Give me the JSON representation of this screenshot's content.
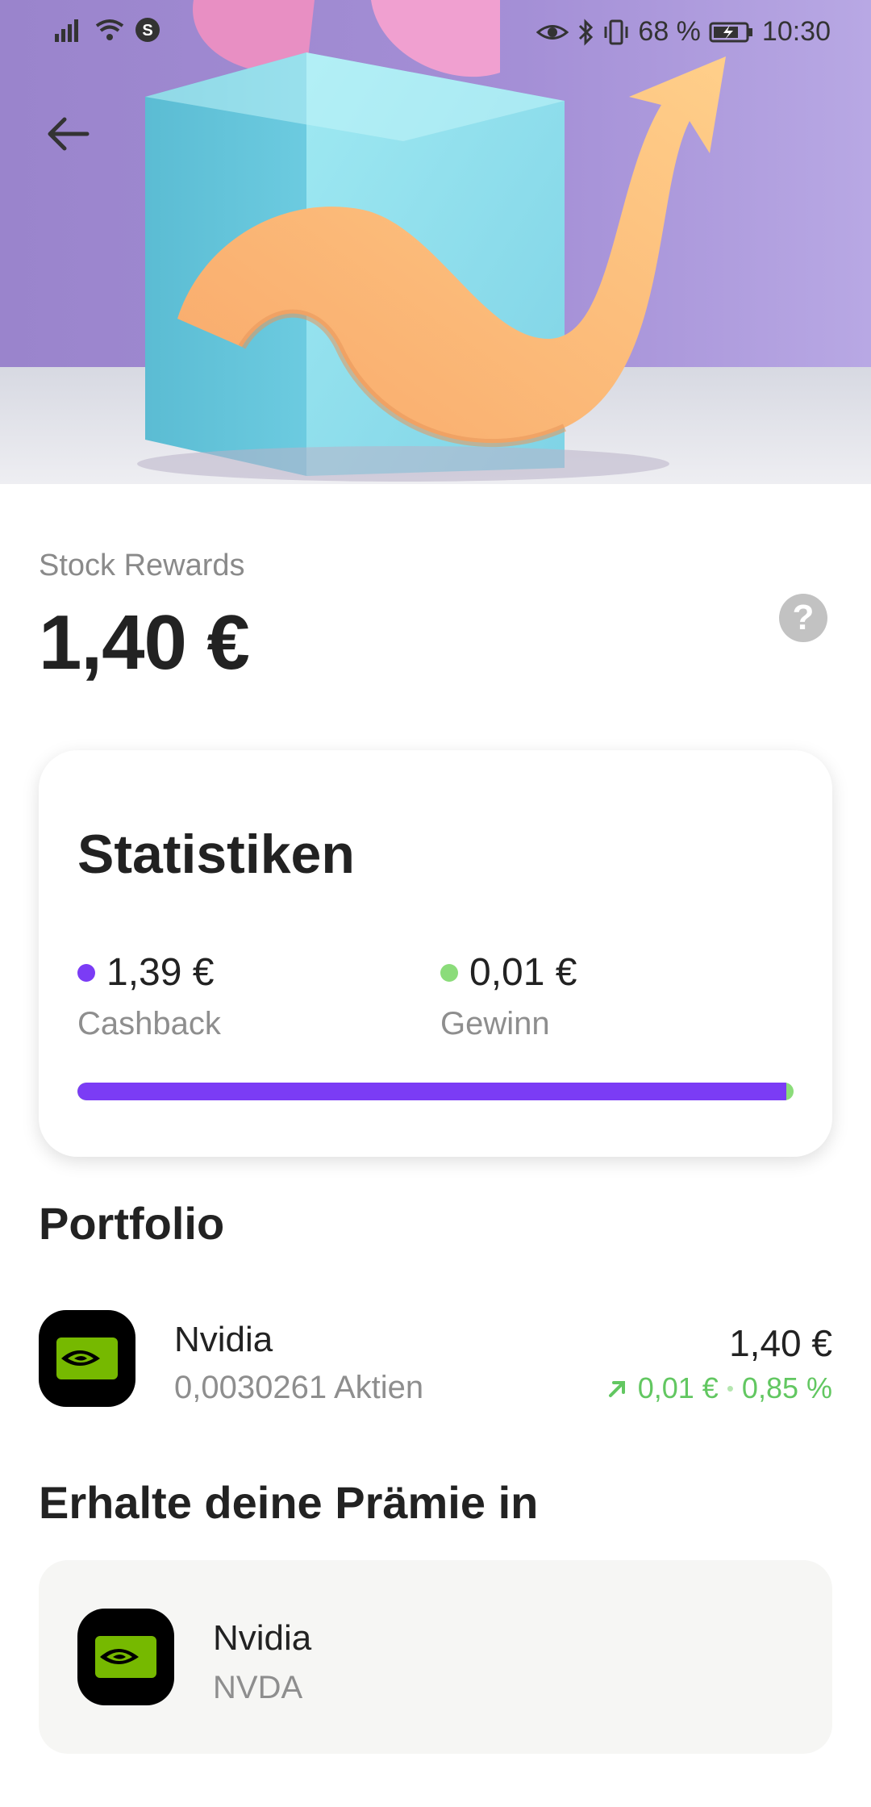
{
  "status_bar": {
    "battery_percent": "68 %",
    "time": "10:30"
  },
  "header": {
    "label": "Stock Rewards",
    "amount": "1,40 €"
  },
  "statistics": {
    "title": "Statistiken",
    "cashback": {
      "value": "1,39 €",
      "label": "Cashback",
      "color": "#7b3cf5"
    },
    "gain": {
      "value": "0,01 €",
      "label": "Gewinn",
      "color": "#8bdc7a"
    },
    "cashback_fraction": 0.99
  },
  "portfolio": {
    "title": "Portfolio",
    "items": [
      {
        "name": "Nvidia",
        "shares": "0,0030261 Aktien",
        "value": "1,40 €",
        "change_amount": "0,01 €",
        "change_percent": "0,85 %"
      }
    ]
  },
  "reward_in": {
    "title": "Erhalte deine Prämie in",
    "item": {
      "name": "Nvidia",
      "ticker": "NVDA"
    }
  },
  "colors": {
    "accent_purple": "#7b3cf5",
    "positive_green": "#62c761"
  }
}
